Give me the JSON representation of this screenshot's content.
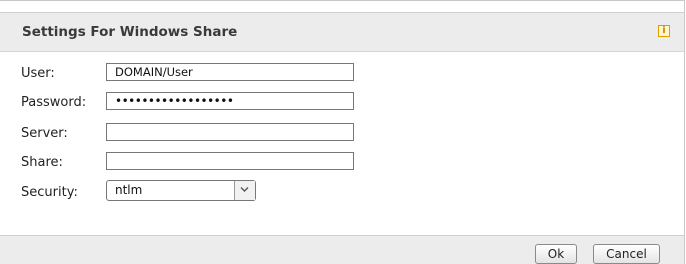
{
  "dialog": {
    "title": "Settings For Windows Share",
    "info_icon": "info-icon",
    "info_glyph": "i"
  },
  "form": {
    "user": {
      "label": "User:",
      "value": "DOMAIN/User"
    },
    "password": {
      "label": "Password:",
      "value": "••••••••••••••••••"
    },
    "server": {
      "label": "Server:",
      "value": ""
    },
    "share": {
      "label": "Share:",
      "value": ""
    },
    "security": {
      "label": "Security:",
      "value": "ntlm",
      "icon": "chevron-down-icon"
    }
  },
  "buttons": {
    "ok": "Ok",
    "cancel": "Cancel"
  },
  "colors": {
    "header_bg": "#ececec",
    "info_icon": "#e0a000"
  }
}
